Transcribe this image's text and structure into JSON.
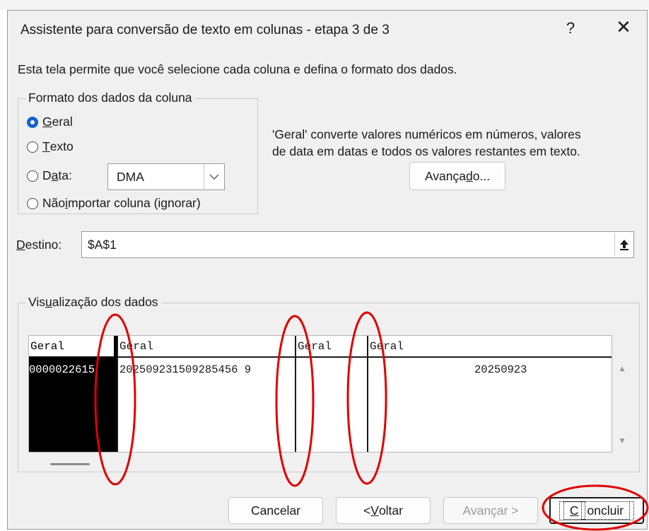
{
  "dialog": {
    "title": "Assistente para conversão de texto em colunas - etapa 3 de 3",
    "help": "?",
    "close": "✕",
    "intro": "Esta tela permite que você selecione cada coluna e defina o formato dos dados."
  },
  "format_group": {
    "legend": "Formato dos dados da coluna",
    "options": [
      {
        "key": "G",
        "rest": "eral",
        "checked": true
      },
      {
        "key": "T",
        "rest": "exto",
        "checked": false
      },
      {
        "pre": "D",
        "key": "a",
        "rest": "ta:",
        "checked": false
      },
      {
        "pre": "Não ",
        "key": "i",
        "rest": "mportar coluna (ignorar)",
        "checked": false
      }
    ],
    "date_select_value": "DMA"
  },
  "description": {
    "line1": "'Geral' converte valores numéricos em números, valores",
    "line2": "de data em datas e todos os valores restantes em texto."
  },
  "advanced_button": {
    "pre": "Avança",
    "key": "d",
    "rest": "o..."
  },
  "destination": {
    "label_key": "D",
    "label_rest": "estino:",
    "value": "$A$1"
  },
  "preview": {
    "legend_pre": "Vis",
    "legend_key": "u",
    "legend_rest": "alização dos dados",
    "columns": [
      {
        "header": "Geral",
        "value": "0000022615"
      },
      {
        "header": "Geral",
        "value": "202509231509285456 9"
      },
      {
        "header": "Geral",
        "value": ""
      },
      {
        "header": "Geral",
        "value": "20250923"
      }
    ]
  },
  "footer": {
    "cancel": "Cancelar",
    "back_pre": "< ",
    "back_key": "V",
    "back_rest": "oltar",
    "next": "Avançar >",
    "finish_key": "C",
    "finish_rest": "oncluir"
  },
  "colors": {
    "accent": "#0f64c8",
    "annotation_red": "#e00000"
  }
}
